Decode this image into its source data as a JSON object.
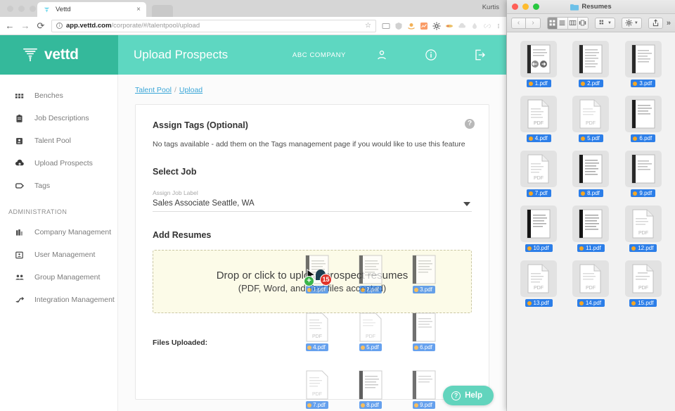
{
  "browser": {
    "tab": {
      "title": "Vettd",
      "close_label": "×",
      "favicon": "vettd-logo-icon"
    },
    "window_user": "Kurtis",
    "nav": {
      "back": "←",
      "forward": "→",
      "reload": "⟳"
    },
    "omnibox": {
      "security_icon": "info-circle-icon",
      "url_host": "app.vettd.com",
      "url_path": "/corporate/#/talentpool/upload",
      "bookmark_icon": "star-icon"
    },
    "extensions": [
      "cast-icon",
      "shield-icon",
      "amazon-icon",
      "chart-icon",
      "gear-icon",
      "ebay-icon",
      "cloud-upload-icon",
      "drop-icon",
      "link-icon",
      "kebab-menu-icon"
    ]
  },
  "app": {
    "brand": "vettd",
    "header": {
      "title": "Upload Prospects",
      "company": "ABC COMPANY",
      "icons": [
        "person-icon",
        "info-icon",
        "logout-icon"
      ]
    },
    "sidebar": {
      "items": [
        {
          "label": "Benches",
          "icon": "grid-icon"
        },
        {
          "label": "Job Descriptions",
          "icon": "clipboard-icon"
        },
        {
          "label": "Talent Pool",
          "icon": "id-badge-icon"
        },
        {
          "label": "Upload Prospects",
          "icon": "cloud-upload-icon"
        },
        {
          "label": "Tags",
          "icon": "tag-icon"
        }
      ],
      "section_label": "ADMINISTRATION",
      "admin_items": [
        {
          "label": "Company Management",
          "icon": "building-icon"
        },
        {
          "label": "User Management",
          "icon": "user-card-icon"
        },
        {
          "label": "Group Management",
          "icon": "people-icon"
        },
        {
          "label": "Integration Management",
          "icon": "integration-icon"
        }
      ]
    },
    "breadcrumb": {
      "parent": "Talent Pool",
      "separator": "/",
      "current": "Upload"
    },
    "card": {
      "help_icon_label": "?",
      "tags_title": "Assign Tags (Optional)",
      "tags_note": "No tags available - add them on the Tags management page if you would like to use this feature",
      "select_job_title": "Select Job",
      "job_field_label": "Assign Job Label",
      "job_field_value": "Sales Associate   Seattle, WA",
      "add_resumes_title": "Add Resumes",
      "dropzone_line1": "Drop or click to upload prospect resumes",
      "dropzone_line2": "(PDF, Word, and Text files accepted)",
      "files_uploaded_label": "Files Uploaded:"
    },
    "help_button": {
      "label": "Help",
      "icon": "question-circle-icon"
    }
  },
  "drag": {
    "count_badge": "15",
    "plus_badge": "+",
    "cursor_icon": "arrow-cursor-icon",
    "ghost_files": [
      "1.pdf",
      "2.pdf",
      "3.pdf",
      "4.pdf",
      "5.pdf",
      "6.pdf",
      "7.pdf",
      "8.pdf",
      "9.pdf"
    ]
  },
  "finder": {
    "window_title": "Resumes",
    "folder_icon": "folder-icon",
    "traffic_lights": [
      "#ff5f57",
      "#febc2e",
      "#28c840"
    ],
    "nav": {
      "back": "‹",
      "forward": "›"
    },
    "view_modes": [
      "icon-view-icon",
      "list-view-icon",
      "column-view-icon",
      "gallery-view-icon"
    ],
    "active_view": "icon-view-icon",
    "toolbar_buttons": [
      "arrange-icon",
      "action-gear-icon",
      "share-icon"
    ],
    "overflow": "»",
    "files": [
      {
        "name": "1.pdf",
        "thumb": "pdf-scan-icon",
        "selected": true
      },
      {
        "name": "2.pdf",
        "thumb": "pdf-scan-icon",
        "selected": true
      },
      {
        "name": "3.pdf",
        "thumb": "pdf-scan-icon",
        "selected": true
      },
      {
        "name": "4.pdf",
        "thumb": "pdf-generic-icon",
        "selected": true
      },
      {
        "name": "5.pdf",
        "thumb": "pdf-generic-icon",
        "selected": true
      },
      {
        "name": "6.pdf",
        "thumb": "pdf-scan-icon",
        "selected": true
      },
      {
        "name": "7.pdf",
        "thumb": "pdf-generic-icon",
        "selected": true
      },
      {
        "name": "8.pdf",
        "thumb": "pdf-scan-icon",
        "selected": true
      },
      {
        "name": "9.pdf",
        "thumb": "pdf-scan-icon",
        "selected": true
      },
      {
        "name": "10.pdf",
        "thumb": "pdf-scan-icon",
        "selected": true
      },
      {
        "name": "11.pdf",
        "thumb": "pdf-scan-icon",
        "selected": true
      },
      {
        "name": "12.pdf",
        "thumb": "pdf-generic-icon",
        "selected": true
      },
      {
        "name": "13.pdf",
        "thumb": "pdf-generic-icon",
        "selected": true
      },
      {
        "name": "14.pdf",
        "thumb": "pdf-generic-icon",
        "selected": true
      },
      {
        "name": "15.pdf",
        "thumb": "pdf-generic-icon",
        "selected": true
      }
    ]
  },
  "colors": {
    "brand_dark": "#34b99b",
    "brand_light": "#5ed7c1",
    "link": "#3aa6d8",
    "dropzone_bg": "#fcfbe8",
    "selection_blue": "#2c7ee8",
    "tag_orange": "#f5a623"
  }
}
